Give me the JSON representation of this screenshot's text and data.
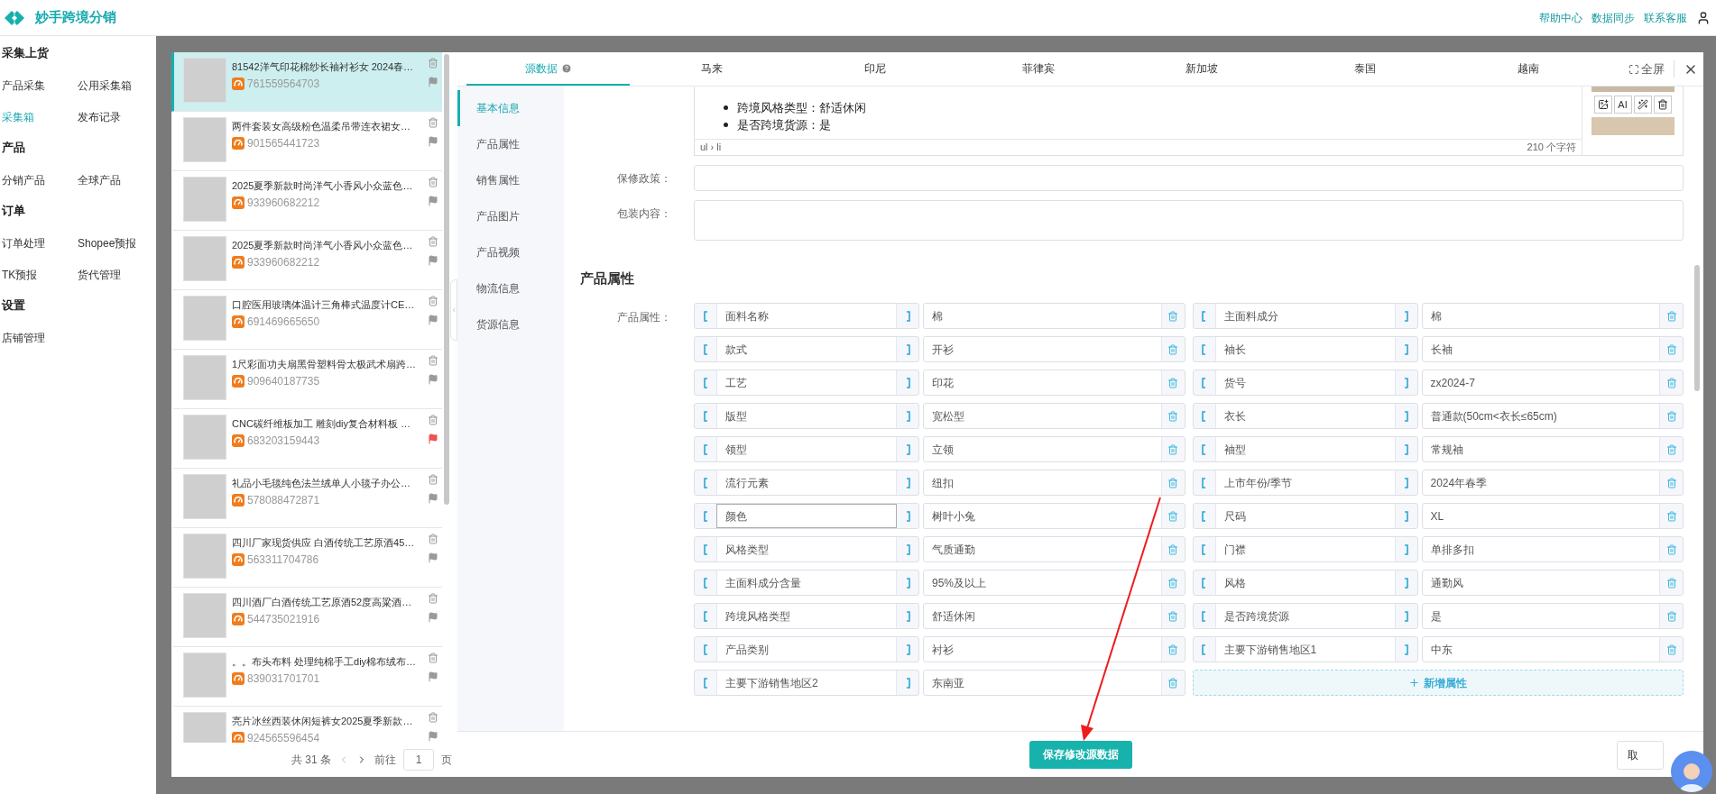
{
  "header": {
    "title": "妙手跨境分销",
    "links": [
      "帮助中心",
      "数据同步",
      "联系客服"
    ]
  },
  "sidebar": {
    "sections": [
      {
        "title": "采集上货",
        "items": [
          {
            "label": "产品采集",
            "selected": false
          },
          {
            "label": "公用采集箱",
            "selected": false
          },
          {
            "label": "采集箱",
            "selected": true
          },
          {
            "label": "发布记录",
            "selected": false
          }
        ]
      },
      {
        "title": "产品",
        "items": [
          {
            "label": "分销产品",
            "selected": false
          },
          {
            "label": "全球产品",
            "selected": false
          }
        ]
      },
      {
        "title": "订单",
        "items": [
          {
            "label": "订单处理",
            "selected": false
          },
          {
            "label": "Shopee预报",
            "selected": false
          },
          {
            "label": "TK预报",
            "selected": false
          },
          {
            "label": "货代管理",
            "selected": false
          }
        ]
      },
      {
        "title": "设置",
        "items": [
          {
            "label": "店铺管理",
            "selected": false
          }
        ]
      }
    ]
  },
  "product_list": {
    "items": [
      {
        "title": "81542洋气印花棉纱长袖衬衫女 2024春…",
        "id": "761559564703",
        "selected": true,
        "flagged": false
      },
      {
        "title": "两件套装女高级粉色温柔吊带连衣裙女…",
        "id": "901565441723",
        "selected": false,
        "flagged": false
      },
      {
        "title": "2025夏季新款时尚洋气小香风小众蓝色…",
        "id": "933960682212",
        "selected": false,
        "flagged": false
      },
      {
        "title": "2025夏季新款时尚洋气小香风小众蓝色…",
        "id": "933960682212",
        "selected": false,
        "flagged": false
      },
      {
        "title": "口腔医用玻璃体温计三角棒式温度计CE…",
        "id": "691469665650",
        "selected": false,
        "flagged": false
      },
      {
        "title": "1尺彩面功夫扇黑骨塑料骨太极武术扇跨…",
        "id": "909640187735",
        "selected": false,
        "flagged": false
      },
      {
        "title": "CNC碳纤维板加工 雕刻diy复合材料板 …",
        "id": "683203159443",
        "selected": false,
        "flagged": true
      },
      {
        "title": "礼品小毛毯纯色法兰绒单人小毯子办公…",
        "id": "578088472871",
        "selected": false,
        "flagged": false
      },
      {
        "title": "四川厂家现货供应 白酒传统工艺原酒45…",
        "id": "563311704786",
        "selected": false,
        "flagged": false
      },
      {
        "title": "四川酒厂白酒传统工艺原酒52度高粱酒…",
        "id": "544735021916",
        "selected": false,
        "flagged": false
      },
      {
        "title": "。。布头布料 处理纯棉手工diy棉布绒布…",
        "id": "839031701701",
        "selected": false,
        "flagged": false
      },
      {
        "title": "亮片冰丝西装休闲短裤女2025夏季新款…",
        "id": "924565596454",
        "selected": false,
        "flagged": false
      }
    ],
    "pagination": {
      "total": "共 31 条",
      "goto": "前往",
      "page": "1",
      "unit": "页"
    }
  },
  "editor": {
    "tabs": [
      {
        "label": "源数据",
        "selected": true,
        "help": true
      },
      {
        "label": "马来",
        "selected": false,
        "help": false
      },
      {
        "label": "印尼",
        "selected": false,
        "help": false
      },
      {
        "label": "菲律宾",
        "selected": false,
        "help": false
      },
      {
        "label": "新加坡",
        "selected": false,
        "help": false
      },
      {
        "label": "泰国",
        "selected": false,
        "help": false
      },
      {
        "label": "越南",
        "selected": false,
        "help": false
      }
    ],
    "fullscreen": "全屏",
    "nav": [
      {
        "label": "基本信息",
        "selected": true
      },
      {
        "label": "产品属性",
        "selected": false
      },
      {
        "label": "销售属性",
        "selected": false
      },
      {
        "label": "产品图片",
        "selected": false
      },
      {
        "label": "产品视频",
        "selected": false
      },
      {
        "label": "物流信息",
        "selected": false
      },
      {
        "label": "货源信息",
        "selected": false
      }
    ],
    "rich_text": {
      "items": [
        "跨境风格类型：舒适休闲",
        "是否跨境货源：是"
      ],
      "path": "ul › li",
      "count": "210 个字符"
    },
    "image_tools": {
      "ai": "AI"
    },
    "fields": [
      {
        "label": "保修政策：",
        "kind": "input"
      },
      {
        "label": "包装内容：",
        "kind": "textarea"
      }
    ],
    "section_title": "产品属性",
    "attributes_label": "产品属性：",
    "attributes": [
      {
        "name": "面料名称",
        "value": "棉",
        "focused": false
      },
      {
        "name": "主面料成分",
        "value": "棉",
        "focused": false
      },
      {
        "name": "款式",
        "value": "开衫",
        "focused": false
      },
      {
        "name": "袖长",
        "value": "长袖",
        "focused": false
      },
      {
        "name": "工艺",
        "value": "印花",
        "focused": false
      },
      {
        "name": "货号",
        "value": "zx2024-7",
        "focused": false
      },
      {
        "name": "版型",
        "value": "宽松型",
        "focused": false
      },
      {
        "name": "衣长",
        "value": "普通款(50cm<衣长≤65cm)",
        "focused": false
      },
      {
        "name": "领型",
        "value": "立领",
        "focused": false
      },
      {
        "name": "袖型",
        "value": "常规袖",
        "focused": false
      },
      {
        "name": "流行元素",
        "value": "纽扣",
        "focused": false
      },
      {
        "name": "上市年份/季节",
        "value": "2024年春季",
        "focused": false
      },
      {
        "name": "颜色",
        "value": "树叶小兔",
        "focused": true
      },
      {
        "name": "尺码",
        "value": "XL",
        "focused": false
      },
      {
        "name": "风格类型",
        "value": "气质通勤",
        "focused": false
      },
      {
        "name": "门襟",
        "value": "单排多扣",
        "focused": false
      },
      {
        "name": "主面料成分含量",
        "value": "95%及以上",
        "focused": false
      },
      {
        "name": "风格",
        "value": "通勤风",
        "focused": false
      },
      {
        "name": "跨境风格类型",
        "value": "舒适休闲",
        "focused": false
      },
      {
        "name": "是否跨境货源",
        "value": "是",
        "focused": false
      },
      {
        "name": "产品类别",
        "value": "衬衫",
        "focused": false
      },
      {
        "name": "主要下游销售地区1",
        "value": "中东",
        "focused": false
      },
      {
        "name": "主要下游销售地区2",
        "value": "东南亚",
        "focused": false
      }
    ],
    "add_attribute": "新增属性",
    "save": "保存修改源数据",
    "cancel": "取"
  }
}
